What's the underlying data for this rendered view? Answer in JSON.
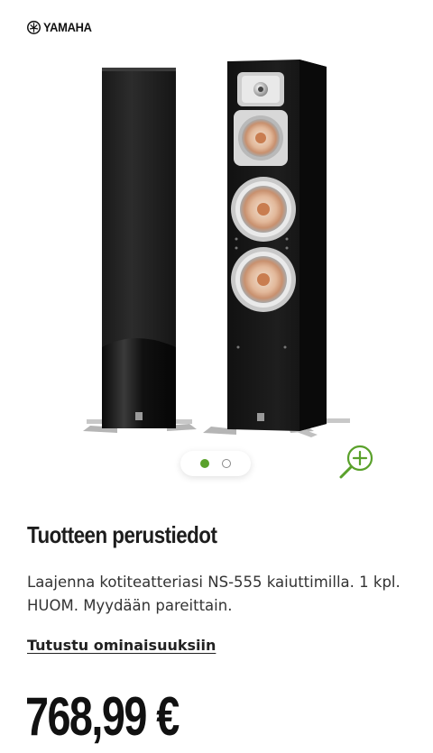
{
  "brand": {
    "name": "YAMAHA",
    "logo_icon": "tuning-fork-logo-icon"
  },
  "gallery": {
    "image_alt": "Yamaha NS-555 floor-standing speakers",
    "slides": [
      {
        "active": true
      },
      {
        "active": false
      }
    ],
    "zoom_icon": "zoom-in-icon",
    "accent_color": "#5aa12b"
  },
  "product": {
    "section_title": "Tuotteen perustiedot",
    "description": "Laajenna kotiteatteriasi NS-555 kaiuttimilla. 1 kpl. HUOM. Myydään pareittain.",
    "features_link": "Tutustu ominaisuuksiin",
    "price": "768,99 €"
  }
}
